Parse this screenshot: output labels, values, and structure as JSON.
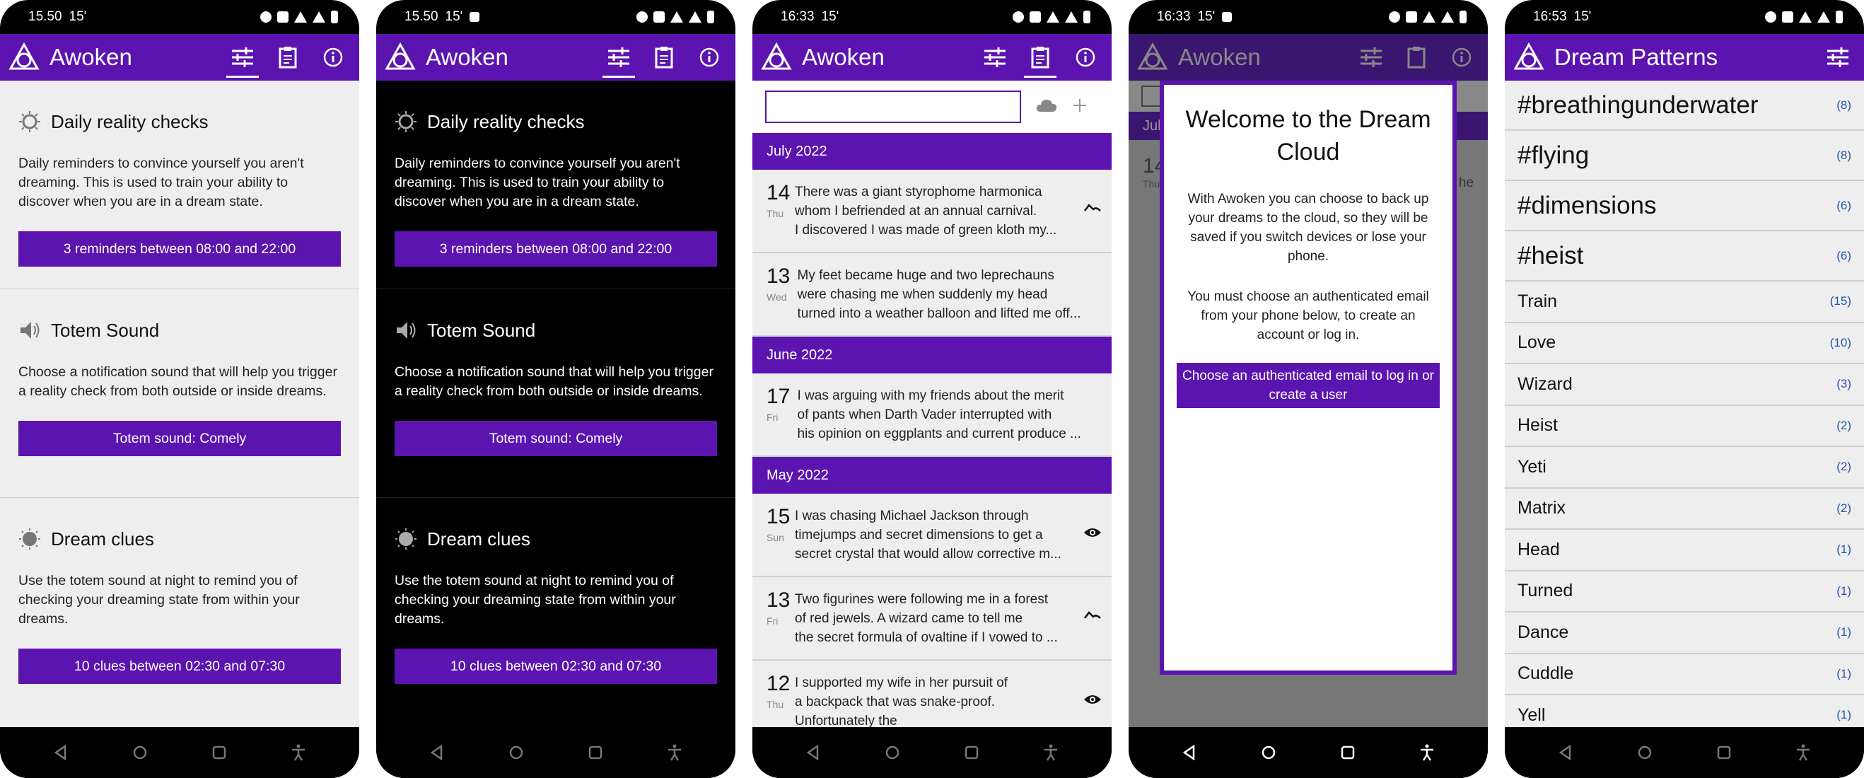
{
  "colors": {
    "accent": "#5b14b0",
    "background_light": "#eeeeee",
    "background_dark": "#000000"
  },
  "app_name": "Awoken",
  "phones": {
    "p1": {
      "status": {
        "time": "15.50",
        "temp": "15'"
      },
      "settings": {
        "reality": {
          "title": "Daily reality checks",
          "text": "Daily reminders to convince yourself you aren't dreaming. This is used to train your ability to discover when you are in a dream state.",
          "button": "3 reminders between 08:00 and 22:00"
        },
        "totem": {
          "title": "Totem Sound",
          "text": "Choose a notification sound that will help you trigger a reality check from both outside or inside dreams.",
          "button": "Totem sound: Comely"
        },
        "clues": {
          "title": "Dream clues",
          "text": "Use the totem sound at night to remind you of checking your dreaming state from within your dreams.",
          "button": "10 clues between 02:30 and 07:30"
        }
      }
    },
    "p2": {
      "status": {
        "time": "15.50",
        "temp": "15'"
      }
    },
    "p3": {
      "status": {
        "time": "16:33",
        "temp": "15'"
      },
      "months": [
        {
          "label": "July 2022",
          "entries": [
            {
              "day": "14",
              "dow": "Thu",
              "lines": [
                "There was a giant styrophome harmonica",
                "whom I befriended at an annual carnival.",
                "I discovered I was made of green kloth my..."
              ],
              "icon": "wave-icon"
            },
            {
              "day": "13",
              "dow": "Wed",
              "lines": [
                "My feet became huge and two leprechauns",
                "were chasing me when suddenly my head",
                "turned into a weather balloon and lifted me off..."
              ],
              "icon": ""
            }
          ]
        },
        {
          "label": "June 2022",
          "entries": [
            {
              "day": "17",
              "dow": "Fri",
              "lines": [
                "I was arguing with my friends about the merit",
                "of pants when Darth Vader interrupted with",
                "his opinion on eggplants and current produce ..."
              ],
              "icon": ""
            }
          ]
        },
        {
          "label": "May 2022",
          "entries": [
            {
              "day": "15",
              "dow": "Sun",
              "lines": [
                "I was chasing Michael Jackson through",
                "timejumps and secret dimensions to get a",
                "secret crystal that would allow corrective m..."
              ],
              "icon": "eye-icon"
            },
            {
              "day": "13",
              "dow": "Fri",
              "lines": [
                "Two figurines were following me in a forest",
                "of red jewels. A wizard came to tell me",
                "the secret formula of ovaltine if I vowed to ..."
              ],
              "icon": "wave-icon"
            },
            {
              "day": "12",
              "dow": "Thu",
              "lines": [
                "I supported my wife in her pursuit of",
                "a backpack that was snake-proof.",
                "Unfortunately the"
              ],
              "icon": "eye-icon"
            }
          ]
        }
      ]
    },
    "p4": {
      "status": {
        "time": "16:33",
        "temp": "15'"
      },
      "bg_fragments": {
        "month": "July",
        "day": "14",
        "dow": "Thu",
        "text": "he"
      },
      "modal": {
        "title": "Welcome to the Dream Cloud",
        "text1": "With Awoken you can choose to back up your dreams to the cloud, so they will be saved if you switch devices or lose your phone.",
        "text2": "You must choose an authenticated email from your phone below, to create an account or log in.",
        "button": "Choose an authenticated email to log in or create a user"
      }
    },
    "p5": {
      "status": {
        "time": "16:53",
        "temp": "15'"
      },
      "title": "Dream Patterns",
      "tags": [
        {
          "name": "#breathingunderwater",
          "count": "(8)"
        },
        {
          "name": "#flying",
          "count": "(8)"
        },
        {
          "name": "#dimensions",
          "count": "(6)"
        },
        {
          "name": "#heist",
          "count": "(6)"
        }
      ],
      "words": [
        {
          "name": "Train",
          "count": "(15)"
        },
        {
          "name": "Love",
          "count": "(10)"
        },
        {
          "name": "Wizard",
          "count": "(3)"
        },
        {
          "name": "Heist",
          "count": "(2)"
        },
        {
          "name": "Yeti",
          "count": "(2)"
        },
        {
          "name": "Matrix",
          "count": "(2)"
        },
        {
          "name": "Head",
          "count": "(1)"
        },
        {
          "name": "Turned",
          "count": "(1)"
        },
        {
          "name": "Dance",
          "count": "(1)"
        },
        {
          "name": "Cuddle",
          "count": "(1)"
        },
        {
          "name": "Yell",
          "count": "(1)"
        }
      ]
    }
  }
}
